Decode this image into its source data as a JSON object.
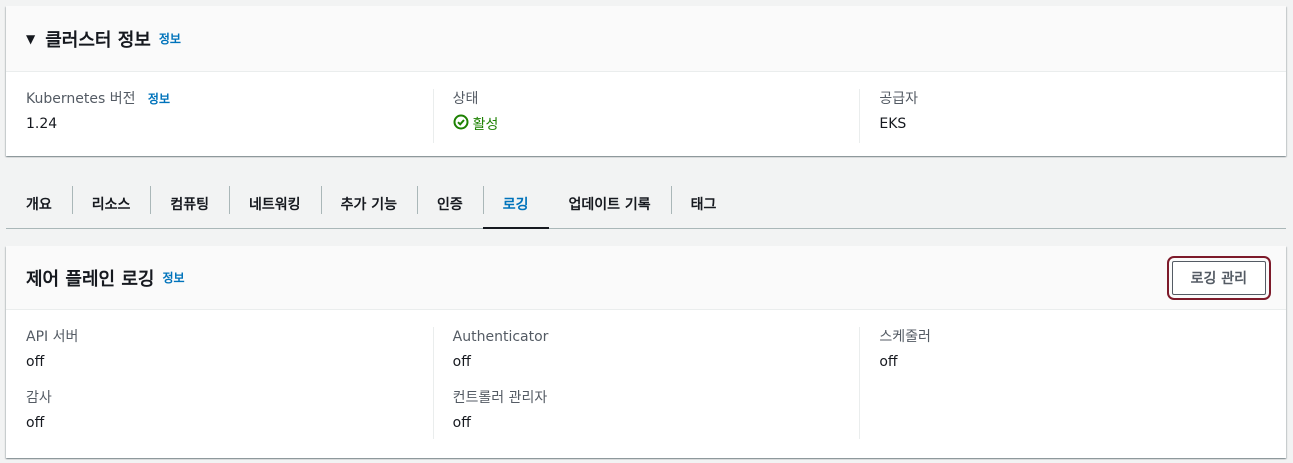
{
  "cluster_info": {
    "title": "클러스터 정보",
    "info": "정보",
    "fields": [
      {
        "label": "Kubernetes 버전",
        "info": "정보",
        "value": "1.24"
      },
      {
        "label": "상태",
        "value": "활성"
      },
      {
        "label": "공급자",
        "value": "EKS"
      }
    ]
  },
  "tabs": [
    "개요",
    "리소스",
    "컴퓨팅",
    "네트워킹",
    "추가 기능",
    "인증",
    "로깅",
    "업데이트 기록",
    "태그"
  ],
  "active_tab": "로깅",
  "logging": {
    "title": "제어 플레인 로깅",
    "info": "정보",
    "manage_button": "로깅 관리",
    "items": [
      {
        "label": "API 서버",
        "value": "off"
      },
      {
        "label": "Authenticator",
        "value": "off"
      },
      {
        "label": "스케줄러",
        "value": "off"
      },
      {
        "label": "감사",
        "value": "off"
      },
      {
        "label": "컨트롤러 관리자",
        "value": "off"
      }
    ]
  },
  "colors": {
    "accent": "#0073bb",
    "success": "#1d8102",
    "highlight": "#7d1a2a"
  }
}
